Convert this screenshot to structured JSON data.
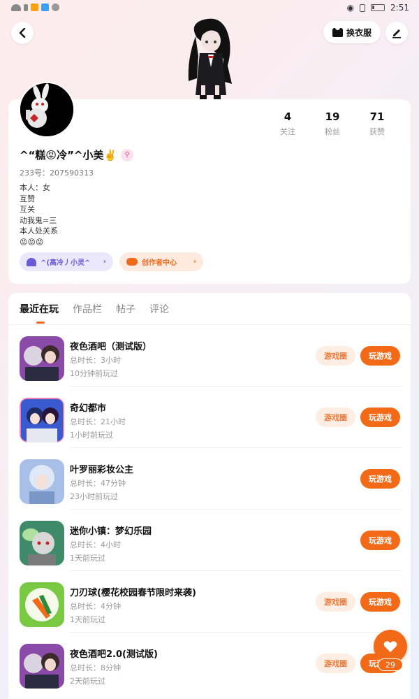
{
  "status_bar": {
    "time": "2:51"
  },
  "header": {
    "dress_label": "换衣服"
  },
  "profile": {
    "username": "^“糕😡冷”^小美✌️",
    "user_id": "233号：207590313",
    "bio": [
      "本人：女",
      "互赞",
      "互关",
      "动我鬼=三",
      "本人处关系",
      "😡😡😡"
    ],
    "stats": [
      {
        "value": "4",
        "label": "关注"
      },
      {
        "value": "19",
        "label": "粉丝"
      },
      {
        "value": "71",
        "label": "获赞"
      }
    ],
    "group_label": "^(高冷丿小灵^",
    "creator_label": "创作者中心"
  },
  "tabs": [
    "最近在玩",
    "作品栏",
    "帖子",
    "评论"
  ],
  "buttons": {
    "circle_label": "游戏圈",
    "play_label": "玩游戏"
  },
  "games": [
    {
      "title": "夜色酒吧（测试版）",
      "duration": "总时长：3小时",
      "last_played": "10分钟前玩过"
    },
    {
      "title": "奇幻都市",
      "duration": "总时长：21小时",
      "last_played": "1小时前玩过"
    },
    {
      "title": "叶罗丽彩妆公主",
      "duration": "总时长：47分钟",
      "last_played": "23小时前玩过"
    },
    {
      "title": "迷你小镇：梦幻乐园",
      "duration": "总时长：4小时",
      "last_played": "1天前玩过"
    },
    {
      "title": "刀刃球(樱花校园春节限时来袭)",
      "duration": "总时长：4分钟",
      "last_played": "1天前玩过"
    },
    {
      "title": "夜色酒吧2.0(测试版)",
      "duration": "总时长：8分钟",
      "last_played": "2天前玩过"
    }
  ],
  "like_count": "29",
  "colors": {
    "accent": "#f26a18",
    "group_pill": "#ebe8fb",
    "creator_pill": "#feeadf"
  }
}
